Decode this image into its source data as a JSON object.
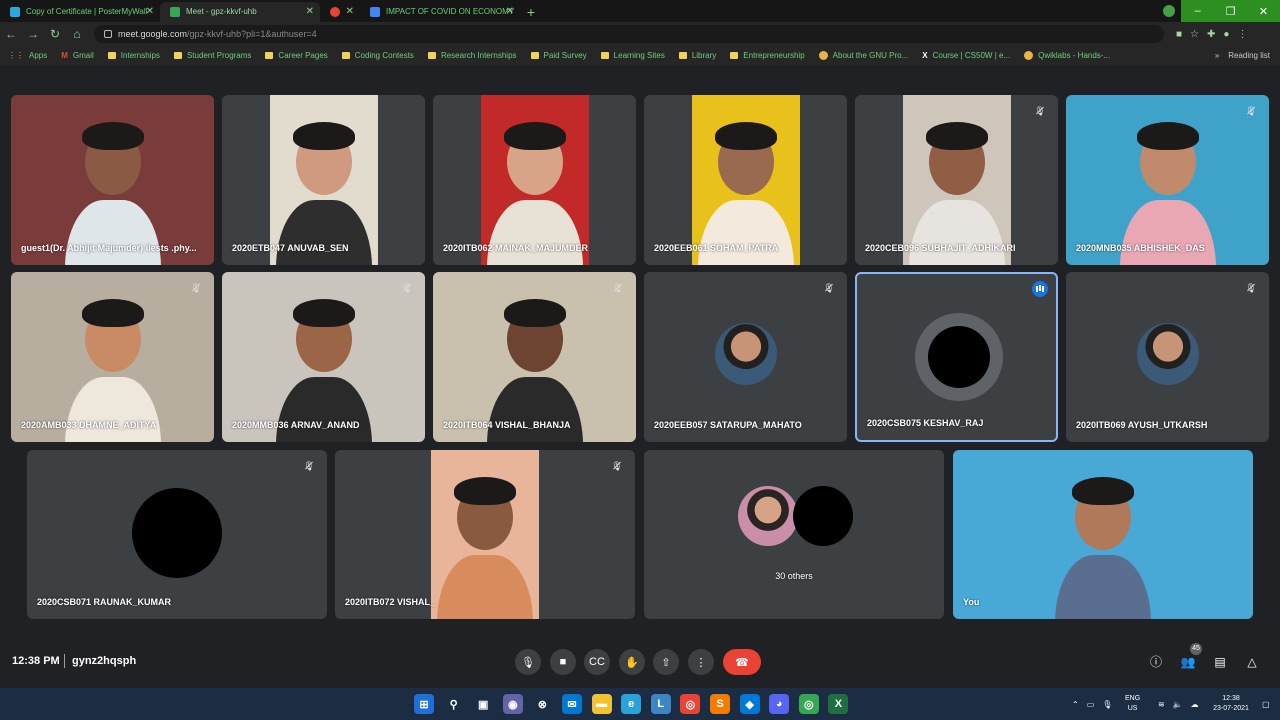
{
  "browser": {
    "tabs": [
      {
        "title": "Copy of Certificate | PosterMyWall",
        "favicon_color": "#29a9e0"
      },
      {
        "title": "Meet - gpz-kkvf-uhb",
        "favicon_color": "#34a853",
        "active": true
      },
      {
        "title": "",
        "favicon_color": "#ea4335"
      },
      {
        "title": "IMPACT OF COVID ON ECONOMY",
        "favicon_color": "#4285f4"
      }
    ],
    "new_tab": "+",
    "url_host": "meet.google.com",
    "url_path": "/gpz-kkvf-uhb?pli=1&authuser=4",
    "bookmarks": [
      {
        "label": "Apps",
        "icon": "apps-grid-icon"
      },
      {
        "label": "Gmail",
        "icon": "gmail-icon"
      },
      {
        "label": "Internships",
        "icon": "folder-icon"
      },
      {
        "label": "Student Programs",
        "icon": "folder-icon"
      },
      {
        "label": "Career Pages",
        "icon": "folder-icon"
      },
      {
        "label": "Coding Contests",
        "icon": "folder-icon"
      },
      {
        "label": "Research Internships",
        "icon": "folder-icon"
      },
      {
        "label": "Paid Survey",
        "icon": "folder-icon"
      },
      {
        "label": "Learning Sites",
        "icon": "folder-icon"
      },
      {
        "label": "Library",
        "icon": "folder-icon"
      },
      {
        "label": "Entrepreneurship",
        "icon": "folder-icon"
      },
      {
        "label": "About the GNU Pro...",
        "icon": "gnu-icon"
      },
      {
        "label": "Course | CS50W | e...",
        "icon": "edx-icon"
      },
      {
        "label": "Qwiklabs - Hands-...",
        "icon": "qwiklabs-icon"
      }
    ],
    "more_bookmarks": "»",
    "reading_list": "Reading list"
  },
  "participants": [
    {
      "name": "guest1(Dr. Abhijit Majumder) iiests .phy...",
      "muted": false,
      "bg": "#7a3b3b",
      "skin": "#8a5a44",
      "shirt": "#dfe6ea"
    },
    {
      "name": "2020ETB047 ANUVAB_SEN",
      "muted": false,
      "bg": "#e2dccf",
      "skin": "#d09a80",
      "shirt": "#2e2e2e"
    },
    {
      "name": "2020ITB062 MAINAK_MAJUMDER",
      "muted": false,
      "bg": "#c22a2a",
      "skin": "#d8a488",
      "shirt": "#e8e1d6"
    },
    {
      "name": "2020EEB061 SOHAM_PATRA",
      "muted": false,
      "bg": "#e8c21a",
      "skin": "#9a6a50",
      "shirt": "#f3e9dd"
    },
    {
      "name": "2020CEB096 SUBHAJIT_ADHIKARI",
      "muted": true,
      "bg": "#cfc6bb",
      "skin": "#8f5e44",
      "shirt": "#e7e4df"
    },
    {
      "name": "2020MNB035 ABHISHEK_DAS",
      "muted": true,
      "bg": "#3fa3c9",
      "skin": "#c18a6c",
      "shirt": "#e9a7b4"
    },
    {
      "name": "2020AMB033 DHAMNE_ADITYA",
      "muted": true,
      "bg": "#b8aea0",
      "skin": "#c98b66",
      "shirt": "#ede7dc"
    },
    {
      "name": "2020MMB036 ARNAV_ANAND",
      "muted": true,
      "bg": "#c9c5bd",
      "skin": "#9b6548",
      "shirt": "#2a2a2a"
    },
    {
      "name": "2020ITB064 VISHAL_BHANJA",
      "muted": true,
      "bg": "#c9c0ad",
      "skin": "#6d4331",
      "shirt": "#2a2a2a"
    },
    {
      "name": "2020EEB057 SATARUPA_MAHATO",
      "muted": true,
      "bg": "#3c4043",
      "avatar": "photo"
    },
    {
      "name": "2020CSB075 KESHAV_RAJ",
      "muted": false,
      "speaking": true,
      "bg": "#3c4043",
      "avatar": "black"
    },
    {
      "name": "2020ITB069 AYUSH_UTKARSH",
      "muted": true,
      "bg": "#3c4043",
      "avatar": "photo"
    },
    {
      "name": "2020CSB071 RAUNAK_KUMAR",
      "muted": true,
      "bg": "#3c4043",
      "avatar": "black"
    },
    {
      "name": "2020ITB072 VISHAL_",
      "muted": true,
      "bg": "#e8b49a",
      "skin": "#8a5a40",
      "shirt": "#d88b5c"
    },
    {
      "name": "30 others",
      "muted": false,
      "bg": "#3c4043",
      "avatar": "group"
    },
    {
      "name": "You",
      "muted": false,
      "bg": "#48a8d6",
      "skin": "#b07a5a",
      "shirt": "#5a6f8f"
    }
  ],
  "meeting": {
    "time": "12:38 PM",
    "separator": "|",
    "code": "gynz2hqsph",
    "participant_count": "45",
    "controls": [
      {
        "name": "microphone-button",
        "icon": "microphone-icon",
        "glyph": "🎙"
      },
      {
        "name": "camera-button",
        "icon": "camera-icon",
        "glyph": "■"
      },
      {
        "name": "captions-button",
        "icon": "captions-icon",
        "glyph": "CC"
      },
      {
        "name": "raise-hand-button",
        "icon": "raise-hand-icon",
        "glyph": "✋"
      },
      {
        "name": "present-button",
        "icon": "present-screen-icon",
        "glyph": "⇧"
      },
      {
        "name": "more-options-button",
        "icon": "more-vert-icon",
        "glyph": "⋮"
      }
    ],
    "end_call_icon": "end-call-icon"
  },
  "taskbar": {
    "apps": [
      {
        "icon": "windows-start-icon",
        "color": "#1f6fd9",
        "glyph": "⊞"
      },
      {
        "icon": "search-icon",
        "color": "transparent",
        "glyph": "⚲"
      },
      {
        "icon": "task-view-icon",
        "color": "transparent",
        "glyph": "▣"
      },
      {
        "icon": "teams-chat-icon",
        "color": "#6264a7",
        "glyph": "◉"
      },
      {
        "icon": "xbox-icon",
        "color": "transparent",
        "glyph": "⊗"
      },
      {
        "icon": "mail-icon",
        "color": "#0078d4",
        "glyph": "✉"
      },
      {
        "icon": "file-explorer-icon",
        "color": "#f2c233",
        "glyph": "▬"
      },
      {
        "icon": "edge-icon",
        "color": "#2aa1d8",
        "glyph": "e"
      },
      {
        "icon": "linkedin-learning-icon",
        "color": "#3d86c6",
        "glyph": "L"
      },
      {
        "icon": "chrome-icon",
        "color": "#ea4335",
        "glyph": "◎"
      },
      {
        "icon": "sublime-icon",
        "color": "#f57c00",
        "glyph": "S"
      },
      {
        "icon": "vscode-icon",
        "color": "#0078d7",
        "glyph": "◆"
      },
      {
        "icon": "discord-icon",
        "color": "#5865f2",
        "glyph": "◕"
      },
      {
        "icon": "chrome-profile-icon",
        "color": "#34a853",
        "glyph": "◎"
      },
      {
        "icon": "excel-icon",
        "color": "#1d6f42",
        "glyph": "X"
      }
    ],
    "language": "ENG",
    "region": "US",
    "clock_time": "12:38",
    "clock_date": "23-07-2021"
  }
}
